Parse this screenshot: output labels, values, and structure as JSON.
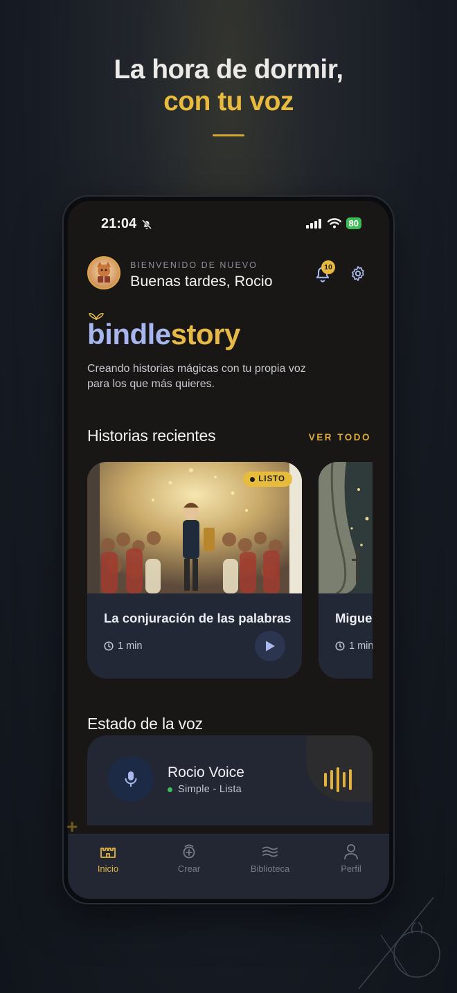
{
  "hero": {
    "line1": "La hora de dormir,",
    "line2": "con tu voz"
  },
  "status_bar": {
    "time": "21:04",
    "battery": "80"
  },
  "header": {
    "welcome_label": "BIENVENIDO DE NUEVO",
    "greeting": "Buenas tardes, Rocio",
    "notification_count": "10"
  },
  "brand": {
    "part1": "bindle",
    "part2": "story",
    "tagline": "Creando historias mágicas con tu propia voz para los que más quieres."
  },
  "recent": {
    "title": "Historias recientes",
    "see_all": "VER TODO",
    "stories": [
      {
        "title": "La conjuración de las palabras",
        "duration": "1 min",
        "badge": "LISTO"
      },
      {
        "title": "Migue",
        "duration": "1 min"
      }
    ]
  },
  "voice": {
    "section_title": "Estado de la voz",
    "name": "Rocio Voice",
    "status": "Simple - Lista"
  },
  "tabs": [
    {
      "label": "Inicio",
      "icon": "home-castle-icon",
      "active": true
    },
    {
      "label": "Crear",
      "icon": "create-icon",
      "active": false
    },
    {
      "label": "Biblioteca",
      "icon": "library-icon",
      "active": false
    },
    {
      "label": "Perfil",
      "icon": "profile-icon",
      "active": false
    }
  ],
  "colors": {
    "accent_gold": "#e6b845",
    "brand_blue": "#a8b6f0",
    "card_bg": "#232836",
    "screen_bg": "#181715",
    "ready_green": "#3bbf57"
  }
}
